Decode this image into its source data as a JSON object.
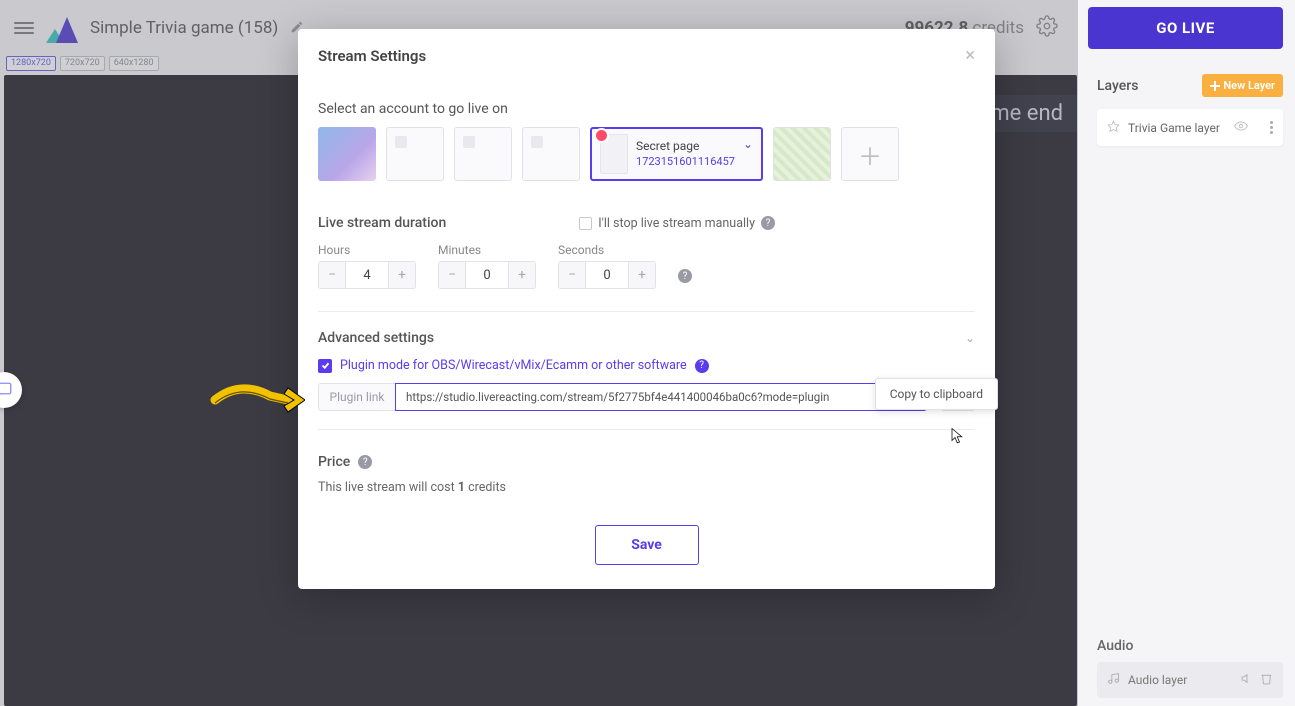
{
  "header": {
    "project_title": "Simple Trivia game (158)",
    "credits_value": "99622.8",
    "credits_label": "credits",
    "go_live": "GO LIVE"
  },
  "canvas": {
    "resolutions": [
      "1280x720",
      "720x720",
      "640x1280"
    ],
    "banner_text": "me end"
  },
  "right": {
    "layers_title": "Layers",
    "new_layer": "New Layer",
    "layer_name": "Trivia Game layer",
    "audio_title": "Audio",
    "audio_layer": "Audio layer"
  },
  "modal": {
    "title": "Stream Settings",
    "select_account": "Select an account to go live on",
    "selected": {
      "name": "Secret page",
      "id": "1723151601116457"
    },
    "duration_title": "Live stream duration",
    "manual_label": "I'll stop live stream manually",
    "hours_label": "Hours",
    "minutes_label": "Minutes",
    "seconds_label": "Seconds",
    "hours_val": "4",
    "minutes_val": "0",
    "seconds_val": "0",
    "advanced_title": "Advanced settings",
    "plugin_label": "Plugin mode for OBS/Wirecast/vMix/Ecamm or other software",
    "plugin_link_label": "Plugin link",
    "plugin_url": "https://studio.livereacting.com/stream/5f2775bf4e441400046ba0c6?mode=plugin",
    "copy_tooltip": "Copy to clipboard",
    "price_title": "Price",
    "price_text_a": "This live stream will cost ",
    "price_credits": "1",
    "price_text_b": " credits",
    "save": "Save"
  }
}
